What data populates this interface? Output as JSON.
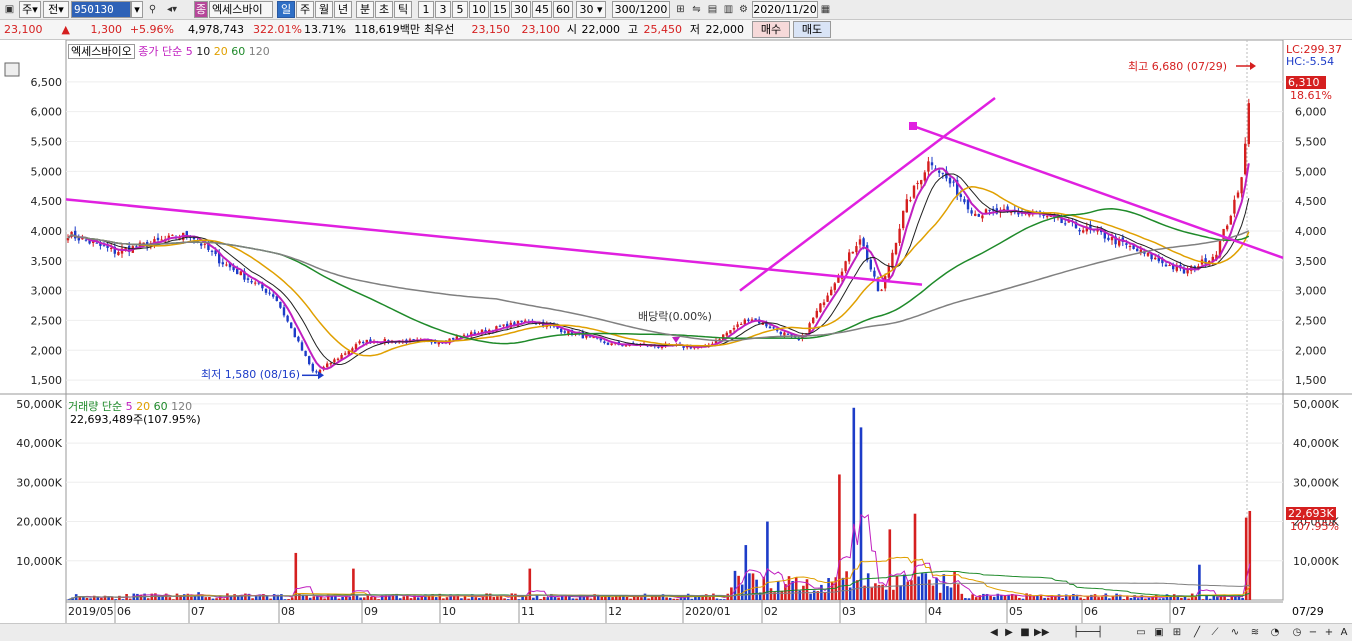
{
  "toolbar": {
    "market": "주",
    "type": "전",
    "code": "950130",
    "mark": "종",
    "name": "엑세스바이",
    "periods": [
      "일",
      "주",
      "월",
      "년",
      "분",
      "초",
      "틱"
    ],
    "selected_period": "일",
    "intervals": [
      "1",
      "3",
      "5",
      "10",
      "15",
      "30",
      "45",
      "60"
    ],
    "custom_interval": "30",
    "count": "300/1200",
    "date": "2020/11/20"
  },
  "quote": {
    "price": "23,100",
    "change": "1,300",
    "change_pct": "+5.96%",
    "volume": "4,978,743",
    "vol_ratio": "322.01%",
    "turnover": "13.71%",
    "amount": "118,619백만",
    "best_label": "최우선",
    "ask": "23,150",
    "bid": "23,100",
    "open_label": "시",
    "open": "22,000",
    "high_label": "고",
    "high": "25,450",
    "low_label": "저",
    "low": "22,000",
    "buy_label": "매수",
    "sell_label": "매도"
  },
  "legend": {
    "stock_name": "엑세스바이오",
    "price_label": "종가 단순",
    "ma": [
      "5",
      "10",
      "20",
      "60",
      "120"
    ],
    "volume_label": "거래량 단순",
    "volume_value": "22,693,489주(107.95%)"
  },
  "annotations": {
    "high": "최고 6,680 (07/29)",
    "low": "최저 1,580 (08/16)",
    "dividend": "배당락(0.00%)",
    "lc": "LC:299.37",
    "hc": "HC:-5.54",
    "last_price": "6,310",
    "last_pct": "18.61%",
    "last_volume": "22,693K",
    "last_vol_pct": "107.95%",
    "right_date": "07/29"
  },
  "colors": {
    "up": "#d51f1f",
    "down": "#1d3cc8",
    "ma5": "#c020c0",
    "ma10": "#202020",
    "ma20": "#e0a000",
    "ma60": "#1f8a2a",
    "ma120": "#808080",
    "trendline": "#e020e0"
  },
  "chart_data": [
    {
      "type": "candlestick",
      "title": "엑세스바이오",
      "ylim": [
        1300,
        6900
      ],
      "y_ticks": [
        "1,500",
        "2,000",
        "2,500",
        "3,000",
        "3,500",
        "4,000",
        "4,500",
        "5,000",
        "5,500",
        "6,000",
        "6,500"
      ],
      "x_ticks": [
        "2019/05",
        "06",
        "07",
        "08",
        "09",
        "10",
        "11",
        "12",
        "2020/01",
        "02",
        "03",
        "04",
        "05",
        "06",
        "07"
      ],
      "anchors": [
        {
          "date": "2019/05",
          "price": 3950
        },
        {
          "date": "2019/06",
          "price": 3650
        },
        {
          "date": "2019/07",
          "price": 3950
        },
        {
          "date": "2019/07 mid",
          "price": 3500
        },
        {
          "date": "2019/08 early",
          "price": 2900
        },
        {
          "date": "2019/08/16",
          "price": 1600
        },
        {
          "date": "2019/09",
          "price": 2150
        },
        {
          "date": "2019/10",
          "price": 2150
        },
        {
          "date": "2019/11",
          "price": 2500
        },
        {
          "date": "2019/12",
          "price": 2100
        },
        {
          "date": "2020/01",
          "price": 2050
        },
        {
          "date": "2020/02 early",
          "price": 2550
        },
        {
          "date": "2020/02 mid",
          "price": 2150
        },
        {
          "date": "2020/03 early",
          "price": 3900
        },
        {
          "date": "2020/03 mid",
          "price": 2900
        },
        {
          "date": "2020/03 late",
          "price": 4400
        },
        {
          "date": "2020/04 early",
          "price": 5200
        },
        {
          "date": "2020/04 mid",
          "price": 4300
        },
        {
          "date": "2020/05",
          "price": 4300
        },
        {
          "date": "2020/06",
          "price": 3950
        },
        {
          "date": "2020/07 early",
          "price": 3300
        },
        {
          "date": "2020/07 mid",
          "price": 3600
        },
        {
          "date": "2020/07/27",
          "price": 4700
        },
        {
          "date": "2020/07/29",
          "price": 6310
        }
      ],
      "high": 6680,
      "low": 1580,
      "last": 6310
    },
    {
      "type": "bar",
      "title": "거래량",
      "ylim": [
        0,
        52000
      ],
      "y_ticks": [
        "10,000K",
        "20,000K",
        "30,000K",
        "40,000K",
        "50,000K"
      ],
      "spikes": [
        {
          "date": "2019/07",
          "value": 2000
        },
        {
          "date": "2019/08 early",
          "value": 12000
        },
        {
          "date": "2019/08 late",
          "value": 8000
        },
        {
          "date": "2019/11",
          "value": 8000
        },
        {
          "date": "2020/01 late",
          "value": 14000
        },
        {
          "date": "2020/02 early",
          "value": 20000
        },
        {
          "date": "2020/03 early",
          "value": 32000
        },
        {
          "date": "2020/03 mid",
          "value": 49000
        },
        {
          "date": "2020/03 mid2",
          "value": 44000
        },
        {
          "date": "2020/03 late",
          "value": 18000
        },
        {
          "date": "2020/04 early",
          "value": 22000
        },
        {
          "date": "2020/07/27",
          "value": 9000
        },
        {
          "date": "2020/07/28",
          "value": 21000
        },
        {
          "date": "2020/07/29",
          "value": 22693
        }
      ],
      "last": 22693
    }
  ]
}
